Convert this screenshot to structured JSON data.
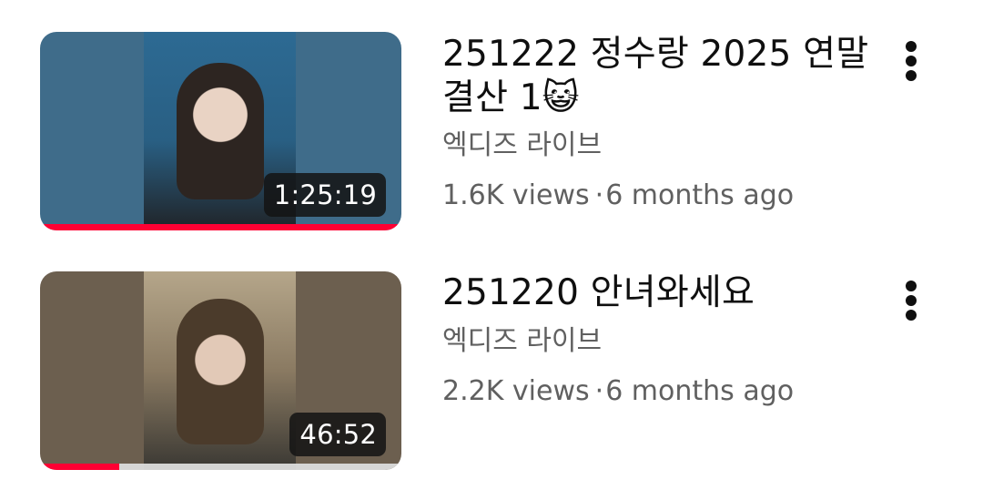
{
  "videos": [
    {
      "title": "251222 정수랑 2025 연말 결산 1😺",
      "channel": "엑디즈 라이브",
      "views": "1.6K views",
      "separator": "·",
      "age": "6 months ago",
      "duration": "1:25:19",
      "watched_fraction": 1.0
    },
    {
      "title": "251220 안녀와세요",
      "channel": "엑디즈 라이브",
      "views": "2.2K views",
      "separator": "·",
      "age": "6 months ago",
      "duration": "46:52",
      "watched_fraction": 0.22
    }
  ],
  "colors": {
    "progress": "#ff0033",
    "title": "#0f0f0f",
    "secondary_text": "#606060"
  },
  "icons": {
    "more": "more-vertical-icon"
  }
}
